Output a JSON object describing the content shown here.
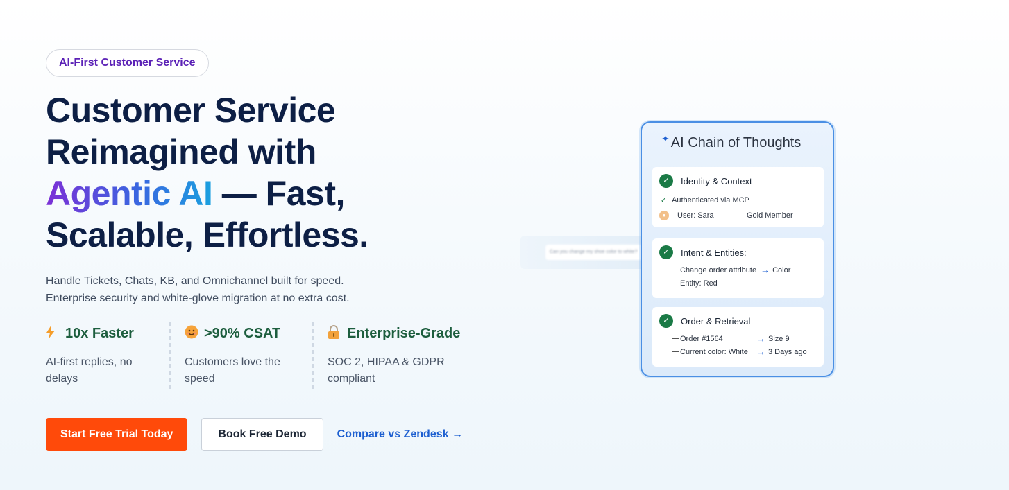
{
  "hero": {
    "badge": "AI-First Customer Service",
    "headline_line1": "Customer Service",
    "headline_line2": "Reimagined with",
    "headline_gradient": "Agentic AI",
    "headline_line3_rest": " — Fast,",
    "headline_line4": "Scalable, Effortless.",
    "sub_line1": "Handle Tickets, Chats, KB, and Omnichannel built for speed.",
    "sub_line2": "Enterprise security and white-glove migration at no extra cost."
  },
  "stats": [
    {
      "icon": "lightning-icon",
      "title": "10x Faster",
      "desc": "AI-first replies, no delays"
    },
    {
      "icon": "smile-icon",
      "title": ">90% CSAT",
      "desc": "Customers love the speed"
    },
    {
      "icon": "lock-icon",
      "title": "Enterprise-Grade",
      "desc": "SOC 2, HIPAA & GDPR compliant"
    }
  ],
  "ctas": {
    "primary": "Start Free Trial Today",
    "secondary": "Book Free Demo",
    "link": "Compare vs Zendesk →"
  },
  "chat_preview": {
    "message": "Can you change my shoe color to white?"
  },
  "card": {
    "title": "AI Chain of Thoughts",
    "identity": {
      "title": "Identity & Context",
      "auth": "Authenticated via MCP",
      "user": "User: Sara",
      "tier": "Gold Member"
    },
    "intent": {
      "title": "Intent & Entities:",
      "row1_left": "Change order attribute",
      "row1_right": "Color",
      "row2": "Entity: Red"
    },
    "order": {
      "title": "Order & Retrieval",
      "row1_left": "Order #1564",
      "row1_right": "Size 9",
      "row2_left": "Current color: White",
      "row2_right": "3 Days ago"
    }
  },
  "colors": {
    "primary_cta": "#ff4a0a",
    "accent_green": "#1d5e3e",
    "link_blue": "#1d5fd0",
    "card_border": "#4a8fe4"
  }
}
